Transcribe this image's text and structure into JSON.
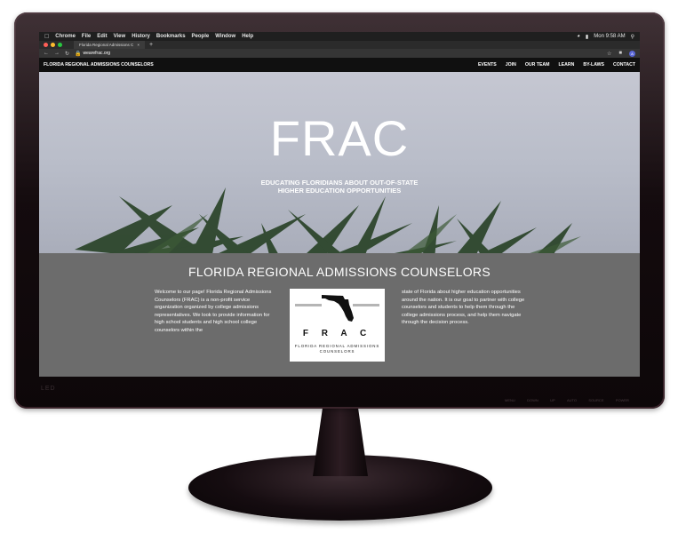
{
  "menubar": {
    "app": "Chrome",
    "items": [
      "File",
      "Edit",
      "View",
      "History",
      "Bookmarks",
      "People",
      "Window",
      "Help"
    ],
    "clock": "Mon 9:58 AM"
  },
  "browser": {
    "tab_title": "Florida Regional Admissions C",
    "url": "wearefrac.org",
    "profile_initial": "A"
  },
  "site": {
    "brand": "FLORIDA REGIONAL ADMISSIONS COUNSELORS",
    "nav": [
      "EVENTS",
      "JOIN",
      "OUR TEAM",
      "LEARN",
      "BY-LAWS",
      "CONTACT"
    ],
    "hero_title": "FRAC",
    "hero_subtitle_line1": "EDUCATING FLORIDIANS ABOUT OUT-OF-STATE",
    "hero_subtitle_line2": "HIGHER EDUCATION OPPORTUNITIES",
    "section_title": "FLORIDA REGIONAL ADMISSIONS COUNSELORS",
    "intro_left": "Welcome to our page! Florida Regional Admissions Counselors (FRAC) is a non-profit service organization organized by college admissions representatives. We look to provide information for high school students and high school college counselors within the",
    "intro_right": "state of Florida about higher education opportunities around the nation. It is our goal to partner with college counselors and students to help them through the college admissions process, and help them navigate through the decision process.",
    "logo": {
      "acronym": "F R A C",
      "caption": "FLORIDA REGIONAL ADMISSIONS COUNSELORS"
    }
  },
  "monitor": {
    "brand_label": "LED",
    "controls": [
      "MENU",
      "DOWN",
      "UP",
      "AUTO",
      "SOURCE",
      "POWER"
    ]
  },
  "icons": [
    "apple-icon",
    "back-icon",
    "forward-icon",
    "reload-icon",
    "lock-icon",
    "star-icon",
    "extension-icon",
    "palm-tree-icon",
    "florida-map-icon"
  ]
}
